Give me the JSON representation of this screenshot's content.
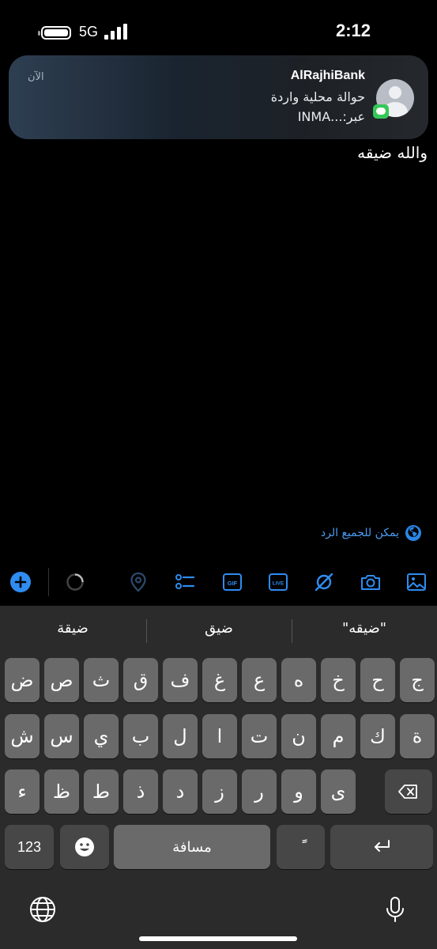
{
  "status_bar": {
    "time": "2:12",
    "network": "5G"
  },
  "notification": {
    "app": "AlRajhiBank",
    "time": "الآن",
    "line1": "حوالة محلية واردة",
    "line2": "عبر:...INMA"
  },
  "typed_text": "والله ضيقه",
  "reply_hint": "يمكن للجميع الرد",
  "toolbar": {
    "icons": [
      "plus-circle-icon",
      "loading-icon",
      "location-icon",
      "checklist-icon",
      "gif-icon",
      "live-icon",
      "disable-icon",
      "camera-icon",
      "image-icon"
    ],
    "gif_label": "GIF",
    "live_label": "LIVE",
    "accent": "#2f8cf0"
  },
  "suggestions": [
    "\"ضيقه\"",
    "ضيق",
    "ضيقة"
  ],
  "keyboard": {
    "row1": [
      "ج",
      "ح",
      "خ",
      "ه",
      "ع",
      "غ",
      "ف",
      "ق",
      "ث",
      "ص",
      "ض"
    ],
    "row2": [
      "ة",
      "ك",
      "م",
      "ن",
      "ت",
      "ا",
      "ل",
      "ب",
      "ي",
      "س",
      "ش"
    ],
    "row3": [
      "ى",
      "و",
      "ر",
      "ز",
      "د",
      "ذ",
      "ط",
      "ظ",
      "ء"
    ],
    "numbers_label": "123",
    "space_label": "مسافة",
    "tanween_label": "ًً"
  }
}
